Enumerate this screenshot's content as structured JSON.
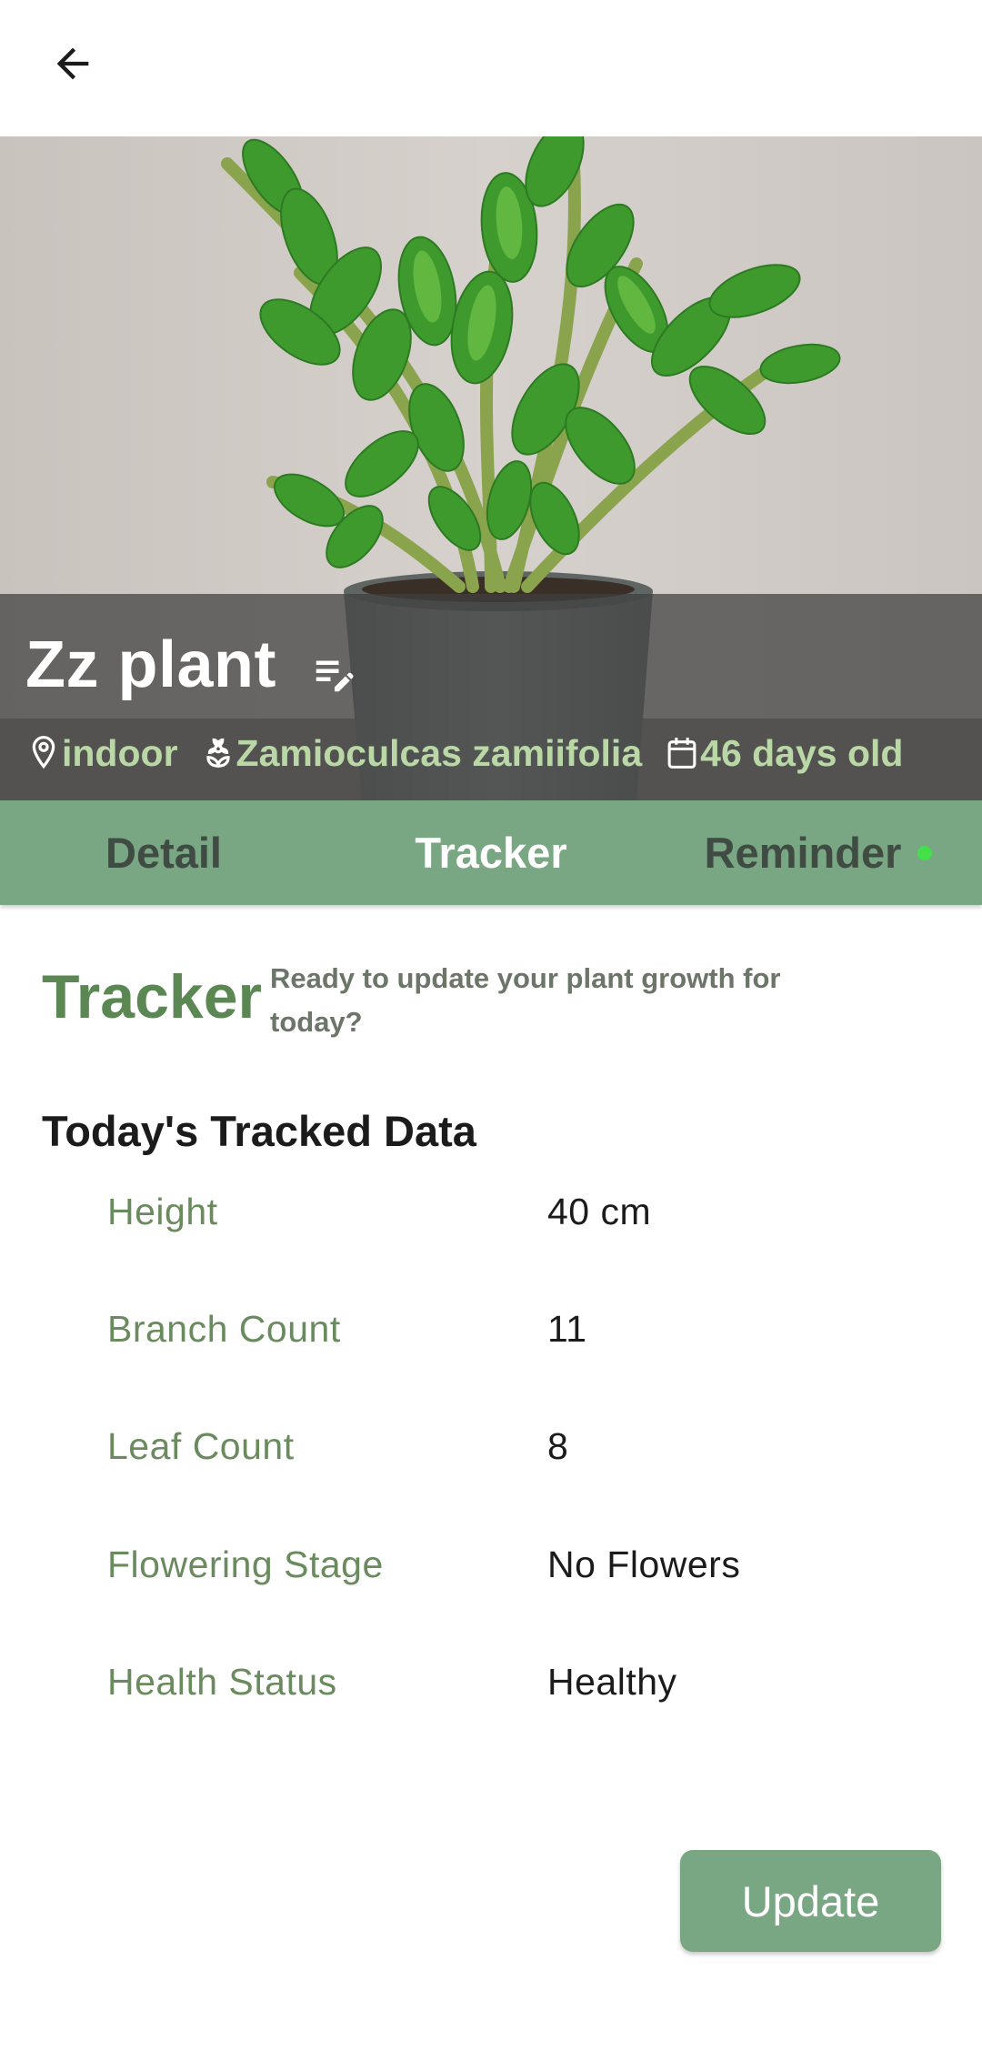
{
  "plant": {
    "name": "Zz plant",
    "location": "indoor",
    "species": "Zamioculcas zamiifolia",
    "age": "46 days old"
  },
  "tabs": [
    {
      "label": "Detail",
      "active": false
    },
    {
      "label": "Tracker",
      "active": true
    },
    {
      "label": "Reminder",
      "active": false,
      "has_dot": true
    }
  ],
  "tracker": {
    "title": "Tracker",
    "subtitle": "Ready to update your plant growth for today?",
    "section_title": "Today's Tracked Data",
    "rows": [
      {
        "label": "Height",
        "value": "40 cm"
      },
      {
        "label": "Branch Count",
        "value": "11"
      },
      {
        "label": "Leaf Count",
        "value": "8"
      },
      {
        "label": "Flowering Stage",
        "value": "No Flowers"
      },
      {
        "label": "Health Status",
        "value": "Healthy"
      }
    ],
    "update_label": "Update"
  },
  "icons": {
    "back": "arrow-left-icon",
    "edit": "edit-note-icon",
    "location": "map-pin-icon",
    "species": "flower-icon",
    "age": "calendar-icon"
  },
  "colors": {
    "accent": "#79a783",
    "title_green": "#5a8752",
    "meta_text": "#b9d8a6",
    "label_green": "#6a8b5e",
    "dot": "#44e04a"
  }
}
